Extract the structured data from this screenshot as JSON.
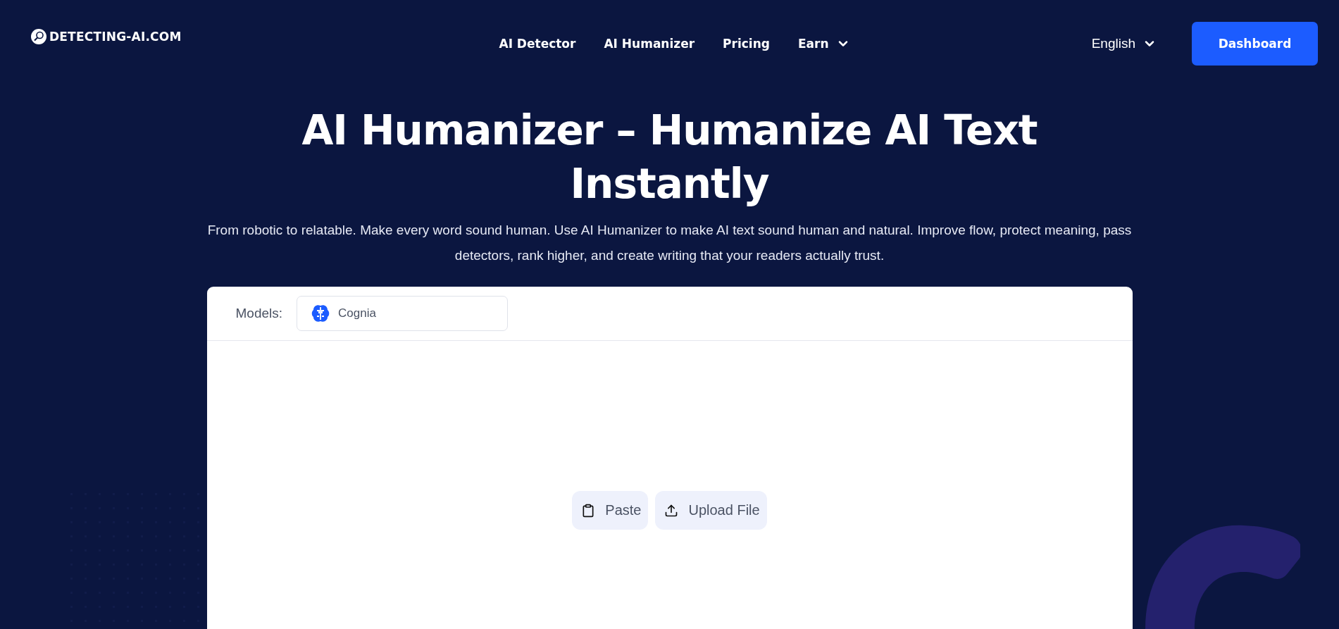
{
  "header": {
    "logo": "DETECTING-AI.COM",
    "nav": [
      {
        "label": "AI Detector",
        "dropdown": false
      },
      {
        "label": "AI Humanizer",
        "dropdown": false
      },
      {
        "label": "Pricing",
        "dropdown": false
      },
      {
        "label": "Earn",
        "dropdown": true
      }
    ],
    "language": "English",
    "cta": "Dashboard"
  },
  "hero": {
    "title": "AI Humanizer – Humanize AI Text Instantly",
    "subtitle": "From robotic to relatable. Make every word sound human. Use AI Humanizer to make AI text sound human and natural. Improve flow, protect meaning, pass detectors, rank higher, and create writing that your readers actually trust."
  },
  "editor": {
    "models_label": "Models:",
    "model": "Cognia",
    "actions": [
      {
        "kind": "paste",
        "label": "Paste"
      },
      {
        "kind": "upload",
        "label": "Upload File"
      }
    ]
  }
}
